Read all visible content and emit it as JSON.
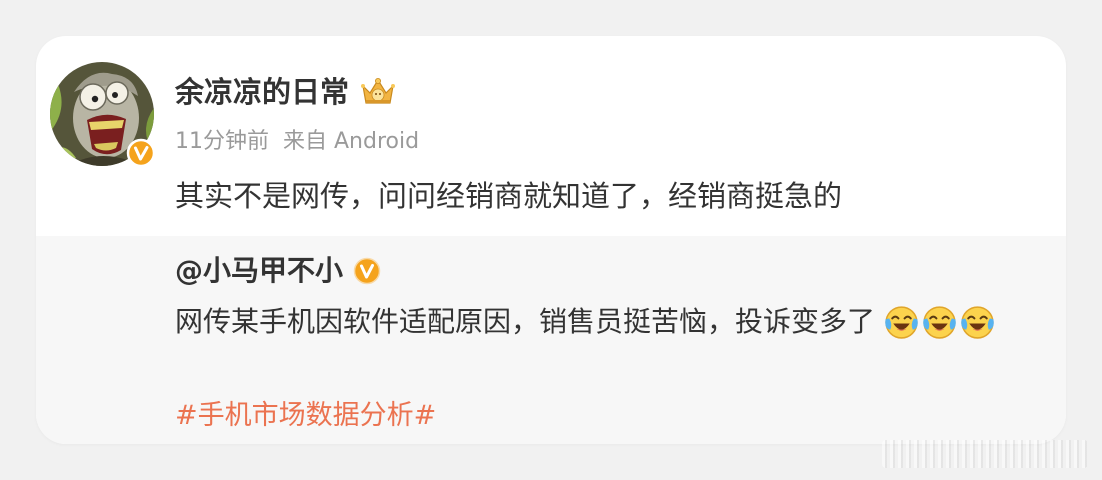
{
  "post": {
    "author": {
      "name": "余凉凉的日常",
      "avatar_icon": "cartoon-avatar-icon",
      "badge_icon": "crown-badge-icon",
      "verified_icon": "verified-badge-icon"
    },
    "time": "11分钟前",
    "source": "来自 Android",
    "text": "其实不是网传，问问经销商就知道了，经销商挺急的"
  },
  "repost": {
    "author": "@小马甲不小",
    "verified_icon": "verified-badge-icon",
    "text": "网传某手机因软件适配原因，销售员挺苦恼，投诉变多了",
    "emojis": [
      "laugh-cry-icon",
      "laugh-cry-icon",
      "laugh-cry-icon"
    ],
    "hashtag": "#手机市场数据分析#"
  },
  "colors": {
    "accent": "#eb7350",
    "verified": "#f5a31c",
    "quote_bg": "#f7f7f7"
  }
}
